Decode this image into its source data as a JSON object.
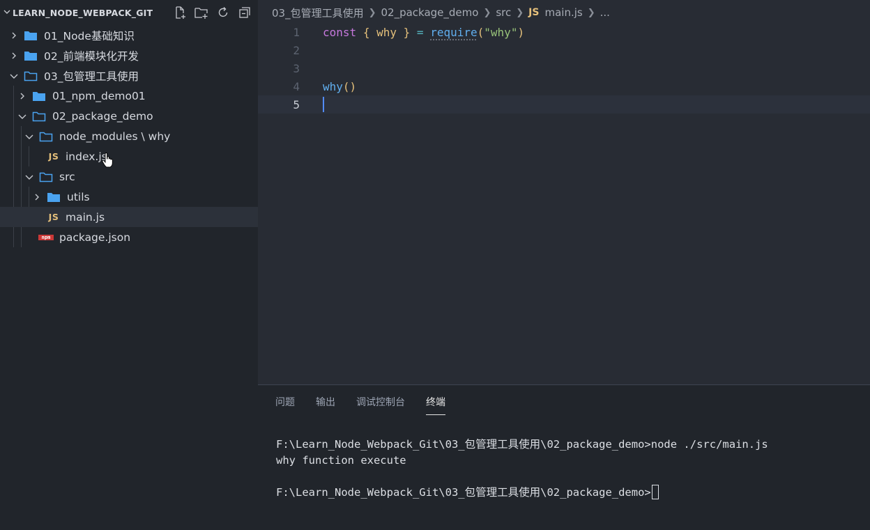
{
  "explorer": {
    "title": "LEARN_NODE_WEBPACK_GIT",
    "actions": [
      "new-file-icon",
      "new-folder-icon",
      "refresh-icon",
      "collapse-all-icon"
    ],
    "items": [
      {
        "label": "01_Node基础知识",
        "type": "folder",
        "expanded": false
      },
      {
        "label": "02_前端模块化开发",
        "type": "folder",
        "expanded": false
      },
      {
        "label": "03_包管理工具使用",
        "type": "folder",
        "expanded": true
      },
      {
        "label": "01_npm_demo01",
        "type": "folder",
        "expanded": false
      },
      {
        "label": "02_package_demo",
        "type": "folder",
        "expanded": true
      },
      {
        "label": "node_modules \\ why",
        "type": "folder",
        "expanded": true
      },
      {
        "label": "index.js",
        "type": "js"
      },
      {
        "label": "src",
        "type": "folder",
        "expanded": true
      },
      {
        "label": "utils",
        "type": "folder",
        "expanded": false
      },
      {
        "label": "main.js",
        "type": "js",
        "selected": true
      },
      {
        "label": "package.json",
        "type": "npm"
      }
    ],
    "js_badge": "JS",
    "npm_badge": "npm"
  },
  "breadcrumb": {
    "parts": [
      "03_包管理工具使用",
      "02_package_demo",
      "src"
    ],
    "file_badge": "JS",
    "file": "main.js",
    "more": "..."
  },
  "editor": {
    "line_numbers": [
      "1",
      "2",
      "3",
      "4",
      "5"
    ],
    "active_line": "5",
    "line1": {
      "kw": "const",
      "open_brace": "{",
      "name": "why",
      "close_brace": "}",
      "eq": "=",
      "fn": "require",
      "open_paren": "(",
      "str": "\"why\"",
      "close_paren": ")"
    },
    "line4": {
      "fn": "why",
      "parens": "()"
    }
  },
  "panel": {
    "tabs": [
      "问题",
      "输出",
      "调试控制台",
      "终端"
    ],
    "active_tab": "终端",
    "terminal_lines": [
      "F:\\Learn_Node_Webpack_Git\\03_包管理工具使用\\02_package_demo>node ./src/main.js",
      "why function execute",
      "",
      "F:\\Learn_Node_Webpack_Git\\03_包管理工具使用\\02_package_demo>"
    ]
  },
  "colors": {
    "sidebar_bg": "#21252b",
    "editor_bg": "#282c34",
    "folder_blue": "#4aa3f0",
    "js_yellow": "#e5c07b",
    "keyword": "#c678dd",
    "function": "#61afef",
    "string": "#98c379"
  }
}
